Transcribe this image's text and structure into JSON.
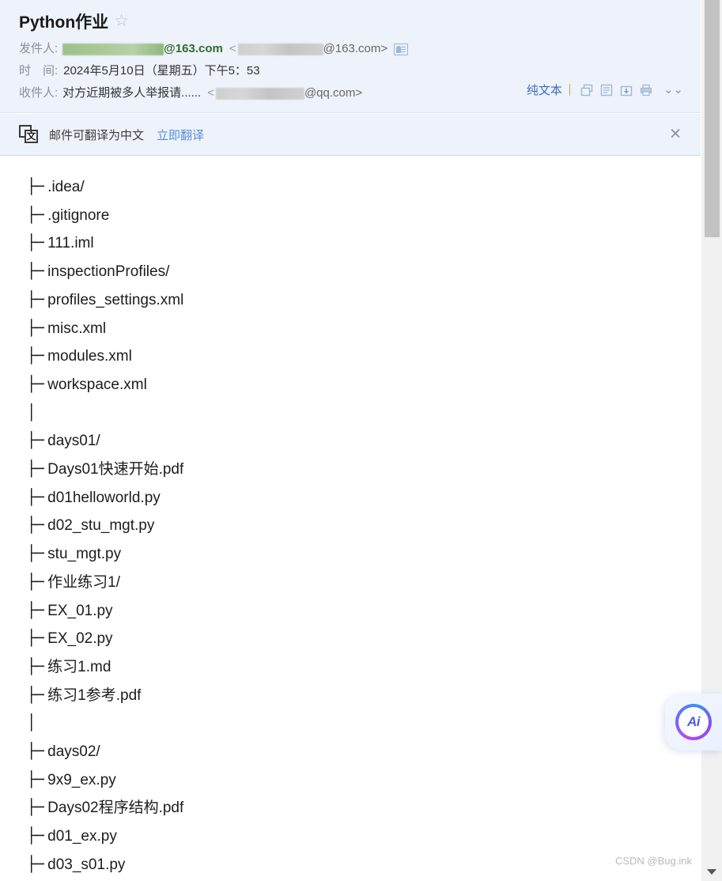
{
  "header": {
    "title": "Python作业",
    "star_icon": "star-icon",
    "sender": {
      "label": "发件人:",
      "display_name_suffix": "@163.com",
      "address_suffix": "@163.com>",
      "angle_open": "<",
      "contact_icon": "contact-card-icon"
    },
    "date": {
      "label": "时　间:",
      "value": "2024年5月10日（星期五）下午5：53"
    },
    "recipient": {
      "label": "收件人:",
      "name": "对方近期被多人举报请......",
      "angle_open": "<",
      "address_suffix": "@qq.com>"
    },
    "actions": {
      "plaintext_label": "纯文本",
      "icons": [
        "open-in-new-window-icon",
        "note-icon",
        "download-icon",
        "print-icon"
      ],
      "expand_label": "⌄⌄",
      "expand_icon": "chevron-double-down-icon"
    }
  },
  "translate_bar": {
    "icon": "translate-icon",
    "icon_glyph": "文",
    "message": "邮件可翻译为中文",
    "action_label": "立即翻译",
    "close_label": "✕",
    "close_icon": "close-icon"
  },
  "body": {
    "tree_lines": [
      {
        "branch": "├─",
        "name": ".idea/"
      },
      {
        "branch": "├─",
        "name": ".gitignore"
      },
      {
        "branch": "├─",
        "name": "111.iml"
      },
      {
        "branch": "├─",
        "name": "inspectionProfiles/"
      },
      {
        "branch": "├─",
        "name": "profiles_settings.xml"
      },
      {
        "branch": "├─",
        "name": "misc.xml"
      },
      {
        "branch": "├─",
        "name": "modules.xml"
      },
      {
        "branch": "├─",
        "name": "workspace.xml"
      },
      {
        "branch": "│",
        "name": ""
      },
      {
        "branch": "├─",
        "name": "days01/"
      },
      {
        "branch": "├─",
        "name": "Days01快速开始.pdf"
      },
      {
        "branch": "├─",
        "name": "d01helloworld.py"
      },
      {
        "branch": "├─",
        "name": "d02_stu_mgt.py"
      },
      {
        "branch": "├─",
        "name": "stu_mgt.py"
      },
      {
        "branch": "├─",
        "name": "作业练习1/"
      },
      {
        "branch": "├─",
        "name": "EX_01.py"
      },
      {
        "branch": "├─",
        "name": "EX_02.py"
      },
      {
        "branch": "├─",
        "name": "练习1.md"
      },
      {
        "branch": "├─",
        "name": "练习1参考.pdf"
      },
      {
        "branch": "│",
        "name": ""
      },
      {
        "branch": "├─",
        "name": "days02/"
      },
      {
        "branch": "├─",
        "name": "9x9_ex.py"
      },
      {
        "branch": "├─",
        "name": "Days02程序结构.pdf"
      },
      {
        "branch": "├─",
        "name": "d01_ex.py"
      },
      {
        "branch": "├─",
        "name": "d03_s01.py"
      }
    ]
  },
  "ai_button": {
    "label": "Ai",
    "icon": "ai-assistant-icon"
  },
  "scrollbar": {
    "thumb_icon": "scrollbar-thumb",
    "arrow_icon": "scroll-down-arrow-icon"
  },
  "watermark": {
    "text": "CSDN @Bug.ink"
  },
  "colors": {
    "header_bg": "#edf2fb",
    "link_blue": "#3b6fb6",
    "translate_link": "#5b8fd6",
    "body_text": "#1c1c1c",
    "label_gray": "#8a8f99",
    "watermark_gray": "#b9b9b9"
  }
}
